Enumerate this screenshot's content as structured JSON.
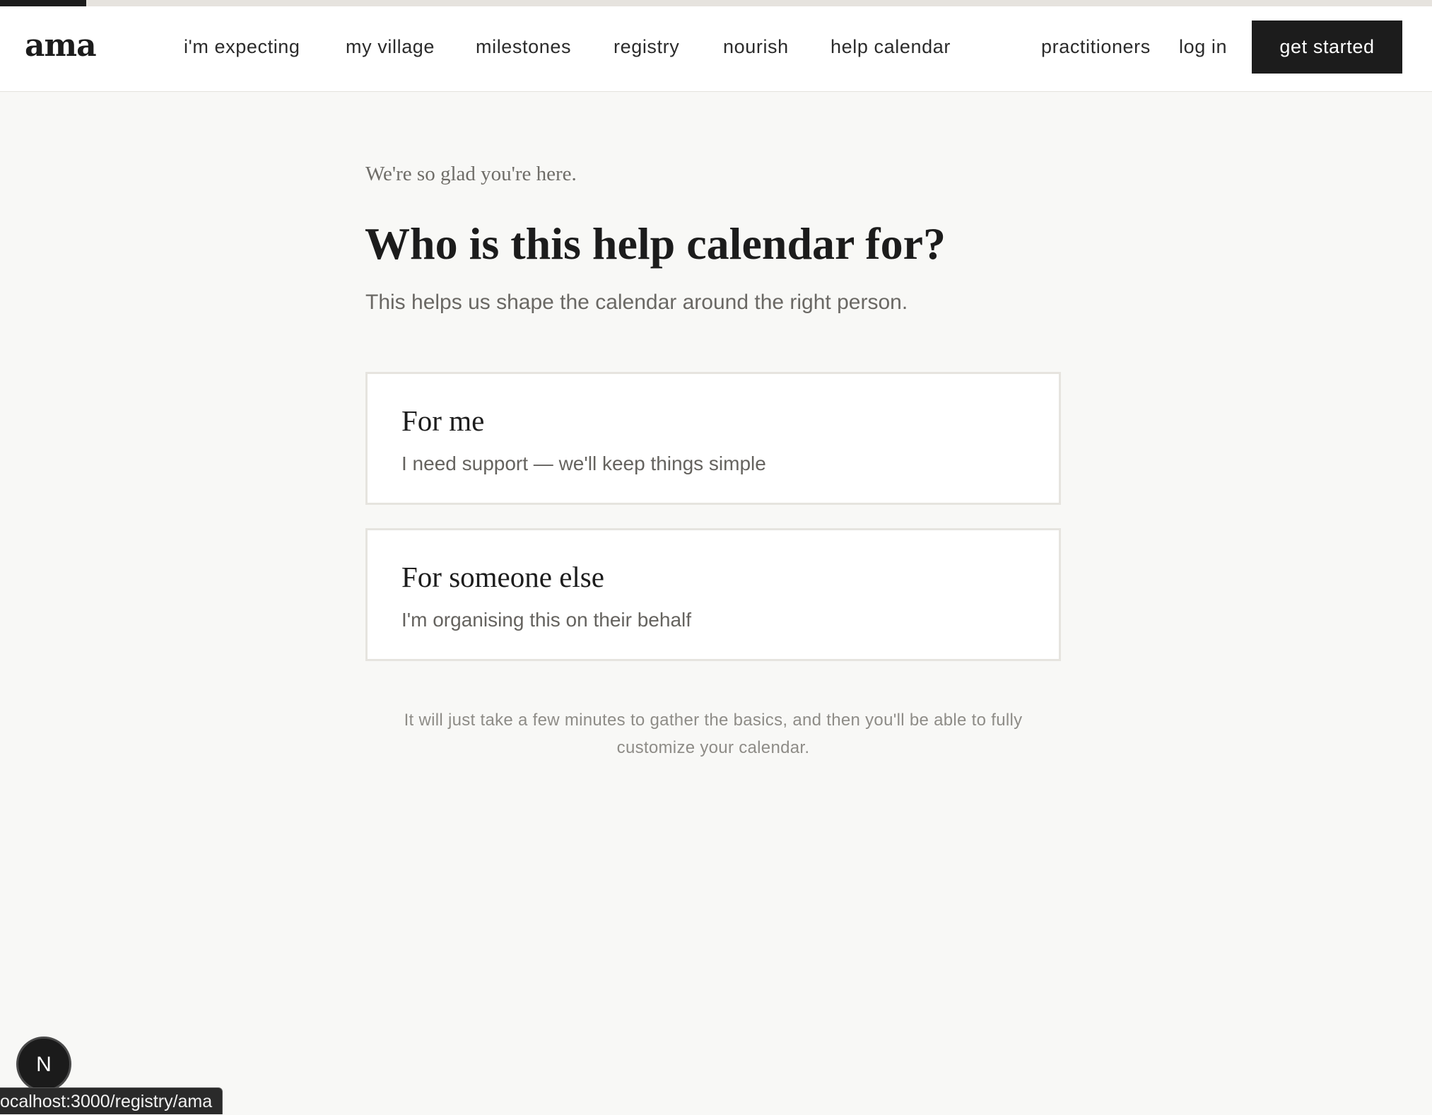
{
  "progress": {
    "fraction": 0.06
  },
  "header": {
    "logo": "ama",
    "nav": [
      {
        "label": "i'm expecting"
      },
      {
        "label": "my village"
      },
      {
        "label": "milestones"
      },
      {
        "label": "registry"
      },
      {
        "label": "nourish"
      },
      {
        "label": "help calendar"
      }
    ],
    "practitioners": "practitioners",
    "login": "log in",
    "cta": "get started"
  },
  "main": {
    "eyebrow": "We're so glad you're here.",
    "title": "Who is this help calendar for?",
    "subtitle": "This helps us shape the calendar around the right person.",
    "options": [
      {
        "title": "For me",
        "description": "I need support — we'll keep things simple"
      },
      {
        "title": "For someone else",
        "description": "I'm organising this on their behalf"
      }
    ],
    "footnote": "It will just take a few minutes to gather the basics, and then you'll be able to fully customize your calendar."
  },
  "dev_badge": {
    "letter": "N",
    "icon": "nextjs-icon"
  },
  "status_bar": {
    "url": "ocalhost:3000/registry/ama"
  }
}
